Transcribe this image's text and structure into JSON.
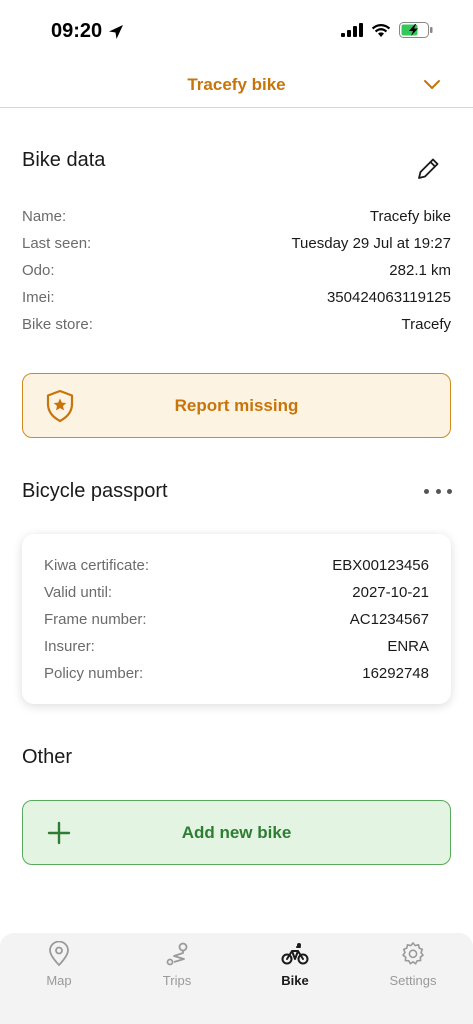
{
  "status_bar": {
    "time": "09:20"
  },
  "header": {
    "title": "Tracefy bike"
  },
  "bike_data": {
    "title": "Bike data",
    "rows": [
      {
        "label": "Name:",
        "value": "Tracefy bike"
      },
      {
        "label": "Last seen:",
        "value": "Tuesday 29 Jul at 19:27"
      },
      {
        "label": "Odo:",
        "value": "282.1 km"
      },
      {
        "label": "Imei:",
        "value": "350424063119125"
      },
      {
        "label": "Bike store:",
        "value": "Tracefy"
      }
    ]
  },
  "report_missing": {
    "label": "Report missing"
  },
  "passport": {
    "title": "Bicycle passport",
    "rows": [
      {
        "label": "Kiwa certificate:",
        "value": "EBX00123456"
      },
      {
        "label": "Valid until:",
        "value": "2027-10-21"
      },
      {
        "label": "Frame number:",
        "value": "AC1234567"
      },
      {
        "label": "Insurer:",
        "value": "ENRA"
      },
      {
        "label": "Policy number:",
        "value": "16292748"
      }
    ]
  },
  "other": {
    "title": "Other",
    "add_label": "Add new bike"
  },
  "tabs": [
    {
      "label": "Map",
      "icon": "map-pin-icon"
    },
    {
      "label": "Trips",
      "icon": "route-icon"
    },
    {
      "label": "Bike",
      "icon": "bike-icon"
    },
    {
      "label": "Settings",
      "icon": "gear-icon"
    }
  ],
  "colors": {
    "accent": "#c7750a",
    "report_bg": "#fdf3e3",
    "add_bg": "#e3f4e3",
    "add_text": "#2e7d32"
  }
}
